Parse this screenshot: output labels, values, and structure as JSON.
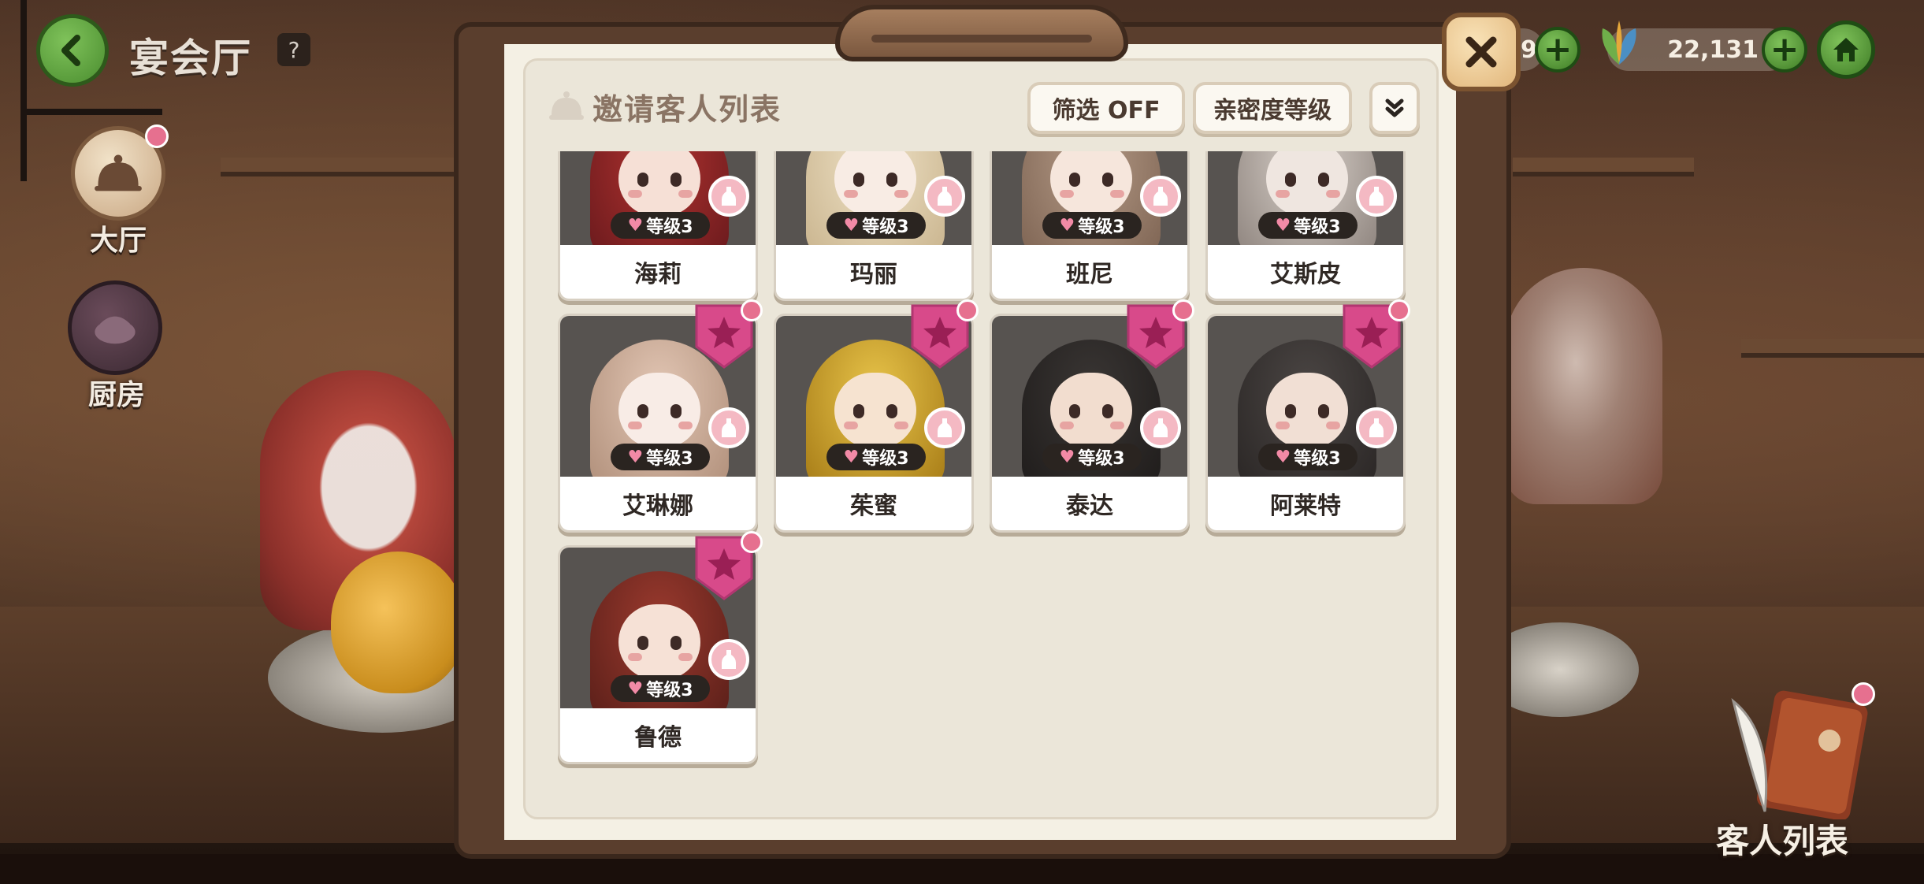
{
  "header": {
    "title": "宴会厅",
    "help_icon": "?"
  },
  "side_nav": [
    {
      "label": "大厅",
      "icon": "cloche-icon"
    },
    {
      "label": "厨房",
      "icon": "pot-icon"
    }
  ],
  "currencies": [
    {
      "value": "9",
      "icon": "coin-icon"
    },
    {
      "value": "22,131",
      "icon": "leaf-icon"
    }
  ],
  "modal": {
    "title": "邀请客人列表",
    "filter_label": "筛选 OFF",
    "sort_label": "亲密度等级"
  },
  "guests": [
    {
      "name": "海莉",
      "level": "等级3",
      "hair": "#b0322f",
      "hair2": "#6a1a1d",
      "skin": "#f6e0d6"
    },
    {
      "name": "玛丽",
      "level": "等级3",
      "hair": "#efe2c6",
      "hair2": "#c9b48e",
      "skin": "#f8ece4"
    },
    {
      "name": "班尼",
      "level": "等级3",
      "hair": "#b49a86",
      "hair2": "#7e6453",
      "skin": "#f6e6dc"
    },
    {
      "name": "艾斯皮",
      "level": "等级3",
      "hair": "#d8d0c9",
      "hair2": "#8d837d",
      "skin": "#efe6e0"
    },
    {
      "name": "艾琳娜",
      "level": "等级3",
      "hair": "#e2c6b4",
      "hair2": "#b08f7a",
      "skin": "#f8ece6"
    },
    {
      "name": "茱蜜",
      "level": "等级3",
      "hair": "#e8c44a",
      "hair2": "#a67b16",
      "skin": "#f6e3d0"
    },
    {
      "name": "泰达",
      "level": "等级3",
      "hair": "#3a3634",
      "hair2": "#1f1c1b",
      "skin": "#f2ddcf"
    },
    {
      "name": "阿莱特",
      "level": "等级3",
      "hair": "#4b4644",
      "hair2": "#2a2625",
      "skin": "#f1dfd4"
    },
    {
      "name": "鲁德",
      "level": "等级3",
      "hair": "#9b3a2e",
      "hair2": "#5a1f19",
      "skin": "#f6e1d6"
    }
  ],
  "guest_list_button": {
    "label": "客人列表"
  },
  "colors": {
    "accent_green": "#5aa33a",
    "badge_pink": "#d84a8a",
    "panel": "#ebe6d9"
  }
}
